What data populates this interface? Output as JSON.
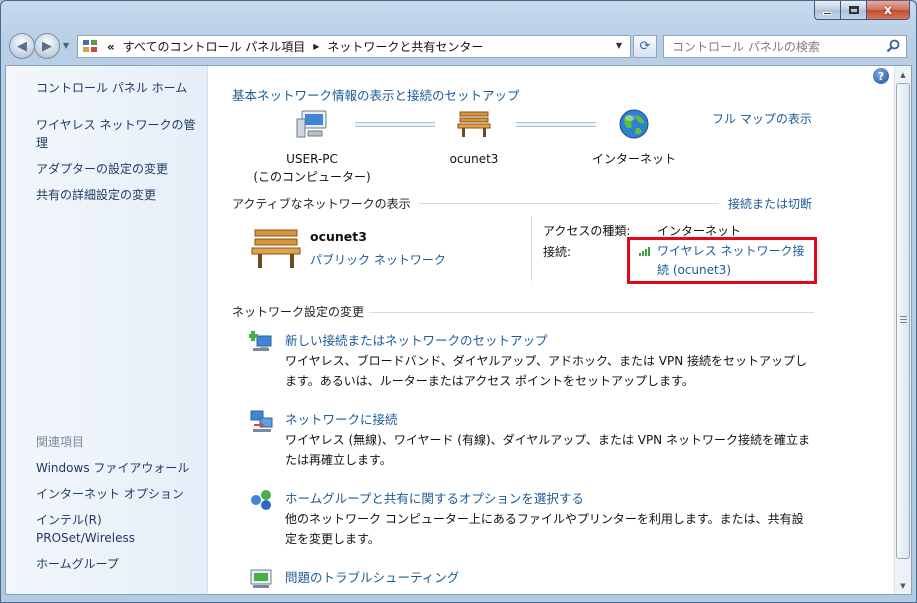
{
  "window": {
    "caption_close": "x"
  },
  "navbar": {
    "address_prefix": "«",
    "breadcrumb": [
      "すべてのコントロール パネル項目",
      "ネットワークと共有センター"
    ],
    "search_placeholder": "コントロール パネルの検索",
    "icon_names": [
      "back-arrow-icon",
      "forward-arrow-icon",
      "refresh-icon",
      "search-icon"
    ]
  },
  "sidebar": {
    "items": [
      {
        "label": "コントロール パネル ホーム"
      },
      {
        "label": "ワイヤレス ネットワークの管理"
      },
      {
        "label": "アダプターの設定の変更"
      },
      {
        "label": "共有の詳細設定の変更"
      }
    ],
    "related_heading": "関連項目",
    "related": [
      {
        "label": "Windows ファイアウォール"
      },
      {
        "label": "インターネット オプション"
      },
      {
        "label": "インテル(R) PROSet/Wireless"
      },
      {
        "label": "ホームグループ"
      }
    ]
  },
  "main": {
    "help": "?",
    "title": "基本ネットワーク情報の表示と接続のセットアップ",
    "full_map_link": "フル マップの表示",
    "map": {
      "computer_name": "USER-PC",
      "computer_sub": "(このコンピューター)",
      "network_name": "ocunet3",
      "internet": "インターネット"
    },
    "active_section": {
      "label": "アクティブなネットワークの表示",
      "connect_link": "接続または切断",
      "network_name": "ocunet3",
      "network_type": "パブリック ネットワーク",
      "access_type_key": "アクセスの種類:",
      "access_type_value": "インターネット",
      "connection_key": "接続:",
      "connection_value": "ワイヤレス ネットワーク接続 (ocunet3)"
    },
    "settings_section": {
      "label": "ネットワーク設定の変更",
      "tasks": [
        {
          "title": "新しい接続またはネットワークのセットアップ",
          "desc": "ワイヤレス、ブロードバンド、ダイヤルアップ、アドホック、または VPN 接続をセットアップします。あるいは、ルーターまたはアクセス ポイントをセットアップします。"
        },
        {
          "title": "ネットワークに接続",
          "desc": "ワイヤレス (無線)、ワイヤード (有線)、ダイヤルアップ、または VPN ネットワーク接続を確立または再確立します。"
        },
        {
          "title": "ホームグループと共有に関するオプションを選択する",
          "desc": "他のネットワーク コンピューター上にあるファイルやプリンターを利用します。または、共有設定を変更します。"
        },
        {
          "title": "問題のトラブルシューティング",
          "desc": ""
        }
      ]
    },
    "highlight_color": "#e3081c",
    "link_color": "#1c5a98"
  }
}
